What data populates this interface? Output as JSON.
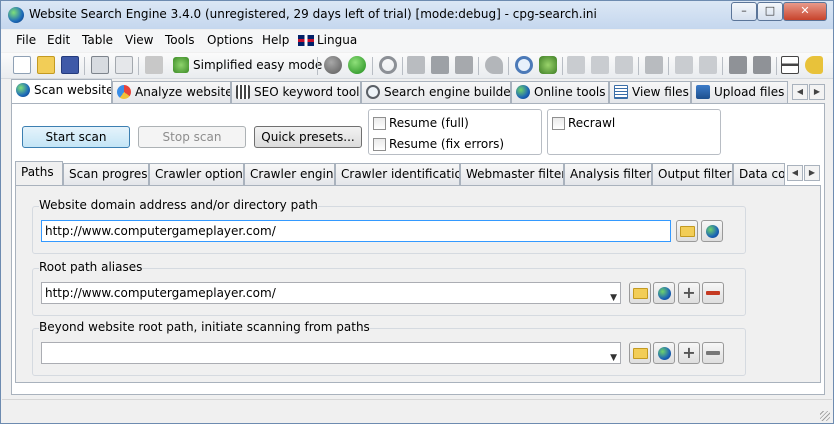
{
  "window": {
    "title": "Website Search Engine 3.4.0 (unregistered, 29 days left of trial) [mode:debug] - cpg-search.ini",
    "controls": {
      "minimize": "–",
      "maximize": "□",
      "close": "✕"
    }
  },
  "menu": [
    "File",
    "Edit",
    "Table",
    "View",
    "Tools",
    "Options",
    "Help",
    "Lingua"
  ],
  "toolbar": {
    "simplified_label": "Simplified easy mode",
    "icons": [
      "new-file-icon",
      "open-folder-icon",
      "save-icon",
      "copy-settings-icon",
      "paste-settings-icon",
      "disabled-icon",
      "simplified-mode-icon",
      "stop-icon",
      "go-icon",
      "refresh-icon",
      "cut-icon",
      "copy-icon",
      "paste-icon",
      "undo-icon",
      "find-icon",
      "find-replace-icon",
      "tree-icon",
      "tree-expand-icon",
      "tree-collapse-icon",
      "move-right-icon",
      "split-icon",
      "merge-icon",
      "align-icon",
      "align-right-icon",
      "buy-icon",
      "key-icon"
    ]
  },
  "main_tabs": [
    {
      "label": "Scan website",
      "icon": "scan-icon",
      "active": true
    },
    {
      "label": "Analyze website",
      "icon": "analyze-icon"
    },
    {
      "label": "SEO keyword tools",
      "icon": "seo-icon"
    },
    {
      "label": "Search engine builder",
      "icon": "search-icon"
    },
    {
      "label": "Online tools",
      "icon": "globe-icon"
    },
    {
      "label": "View files",
      "icon": "view-files-icon"
    },
    {
      "label": "Upload files",
      "icon": "upload-icon"
    }
  ],
  "scan": {
    "start_label": "Start scan",
    "stop_label": "Stop scan",
    "presets_label": "Quick presets...",
    "resume_full": "Resume (full)",
    "resume_fix": "Resume (fix errors)",
    "recrawl": "Recrawl"
  },
  "sub_tabs": [
    {
      "label": "Paths",
      "active": true
    },
    {
      "label": "Scan progress"
    },
    {
      "label": "Crawler options"
    },
    {
      "label": "Crawler engine"
    },
    {
      "label": "Crawler identification"
    },
    {
      "label": "Webmaster filters"
    },
    {
      "label": "Analysis filters"
    },
    {
      "label": "Output filters"
    },
    {
      "label": "Data colle"
    }
  ],
  "paths": {
    "domain_label": "Website domain address and/or directory path",
    "domain_value": "http://www.computergameplayer.com/",
    "aliases_label": "Root path aliases",
    "aliases_value": "http://www.computergameplayer.com/",
    "beyond_label": "Beyond website root path, initiate scanning from paths",
    "beyond_value": ""
  },
  "colors": {
    "accent": "#3399ff",
    "title_bar": "#c5d7ee",
    "close_button": "#c7432c",
    "remove_button": "#c53a22"
  }
}
